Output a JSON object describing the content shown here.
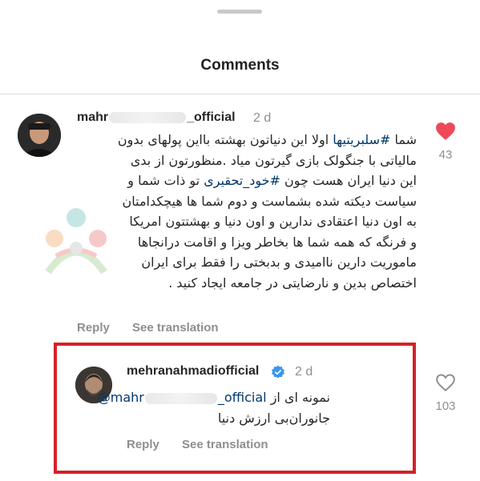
{
  "sheet": {
    "title": "Comments"
  },
  "comments": [
    {
      "username_prefix": "mahr",
      "username_suffix": "_official",
      "timestamp": "2 d",
      "body_lines": [
        {
          "before": "شما ",
          "tag": "#سلبریتیها",
          "after": " اولا این دنیاتون بهشته بااین پولهای بدون"
        },
        {
          "before": "مالیاتی با جنگولک بازی گیرتون میاد .منظورتون از بدی",
          "tag": "",
          "after": ""
        },
        {
          "before": "این دنیا ایران هست چون ",
          "tag": "#خود_تحقیری",
          "after": " تو ذات شما و"
        },
        {
          "before": "سیاست دیکته شده بشماست و دوم شما ها هیچکدامتان",
          "tag": "",
          "after": ""
        },
        {
          "before": "به اون دنیا اعتقادی ندارین و اون دنیا و بهشتتون امریکا",
          "tag": "",
          "after": ""
        },
        {
          "before": "و فرنگه که همه  شما ها بخاطر ویزا و اقامت درانجاها",
          "tag": "",
          "after": ""
        },
        {
          "before": "ماموریت دارین ناامیدی و بدبختی را فقط برای ایران",
          "tag": "",
          "after": ""
        },
        {
          "before": "اختصاص بدین و نارضایتی  در جامعه ایجاد کنید .",
          "tag": "",
          "after": ""
        }
      ],
      "reply_label": "Reply",
      "translate_label": "See translation",
      "like_count": "43",
      "liked": true,
      "heart_color": "#ed4956"
    },
    {
      "username": "mehranahmadiofficial",
      "verified": true,
      "timestamp": "2 d",
      "mention_prefix": "@mahr",
      "mention_suffix": "_official",
      "line1_text": "نمونه ای از",
      "line2_text": "جانوران‌بی ارزش دنیا",
      "reply_label": "Reply",
      "translate_label": "See translation",
      "like_count": "103",
      "liked": false,
      "highlight_color": "#d42027"
    }
  ],
  "icons": {
    "like_filled": "heart-filled-icon",
    "like_outline": "heart-outline-icon",
    "verified": "verified-badge-icon"
  },
  "colors": {
    "link": "#00376b",
    "muted": "#8e8e8e",
    "verified_blue": "#3897f0"
  }
}
